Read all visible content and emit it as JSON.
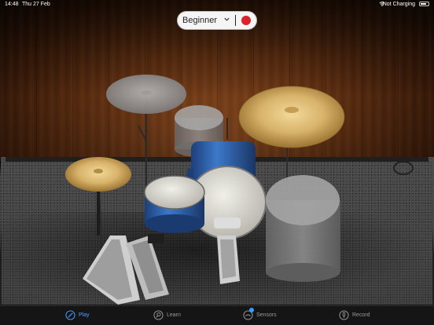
{
  "status_bar": {
    "time": "14:48",
    "date": "Thu 27 Feb",
    "battery_status": "Not Charging"
  },
  "top_control": {
    "level": "Beginner",
    "record_color": "#d9232a"
  },
  "tabs": [
    {
      "label": "Play",
      "icon": "drumstick-icon",
      "active": true
    },
    {
      "label": "Learn",
      "icon": "magnifier-icon",
      "active": false
    },
    {
      "label": "Sensors",
      "icon": "sensor-icon",
      "active": false
    },
    {
      "label": "Record",
      "icon": "microphone-icon",
      "active": false
    }
  ],
  "colors": {
    "accent": "#4aa3ff",
    "cymbal_gold": "#d7b572",
    "drum_shell_blue": "#2e66b8"
  }
}
